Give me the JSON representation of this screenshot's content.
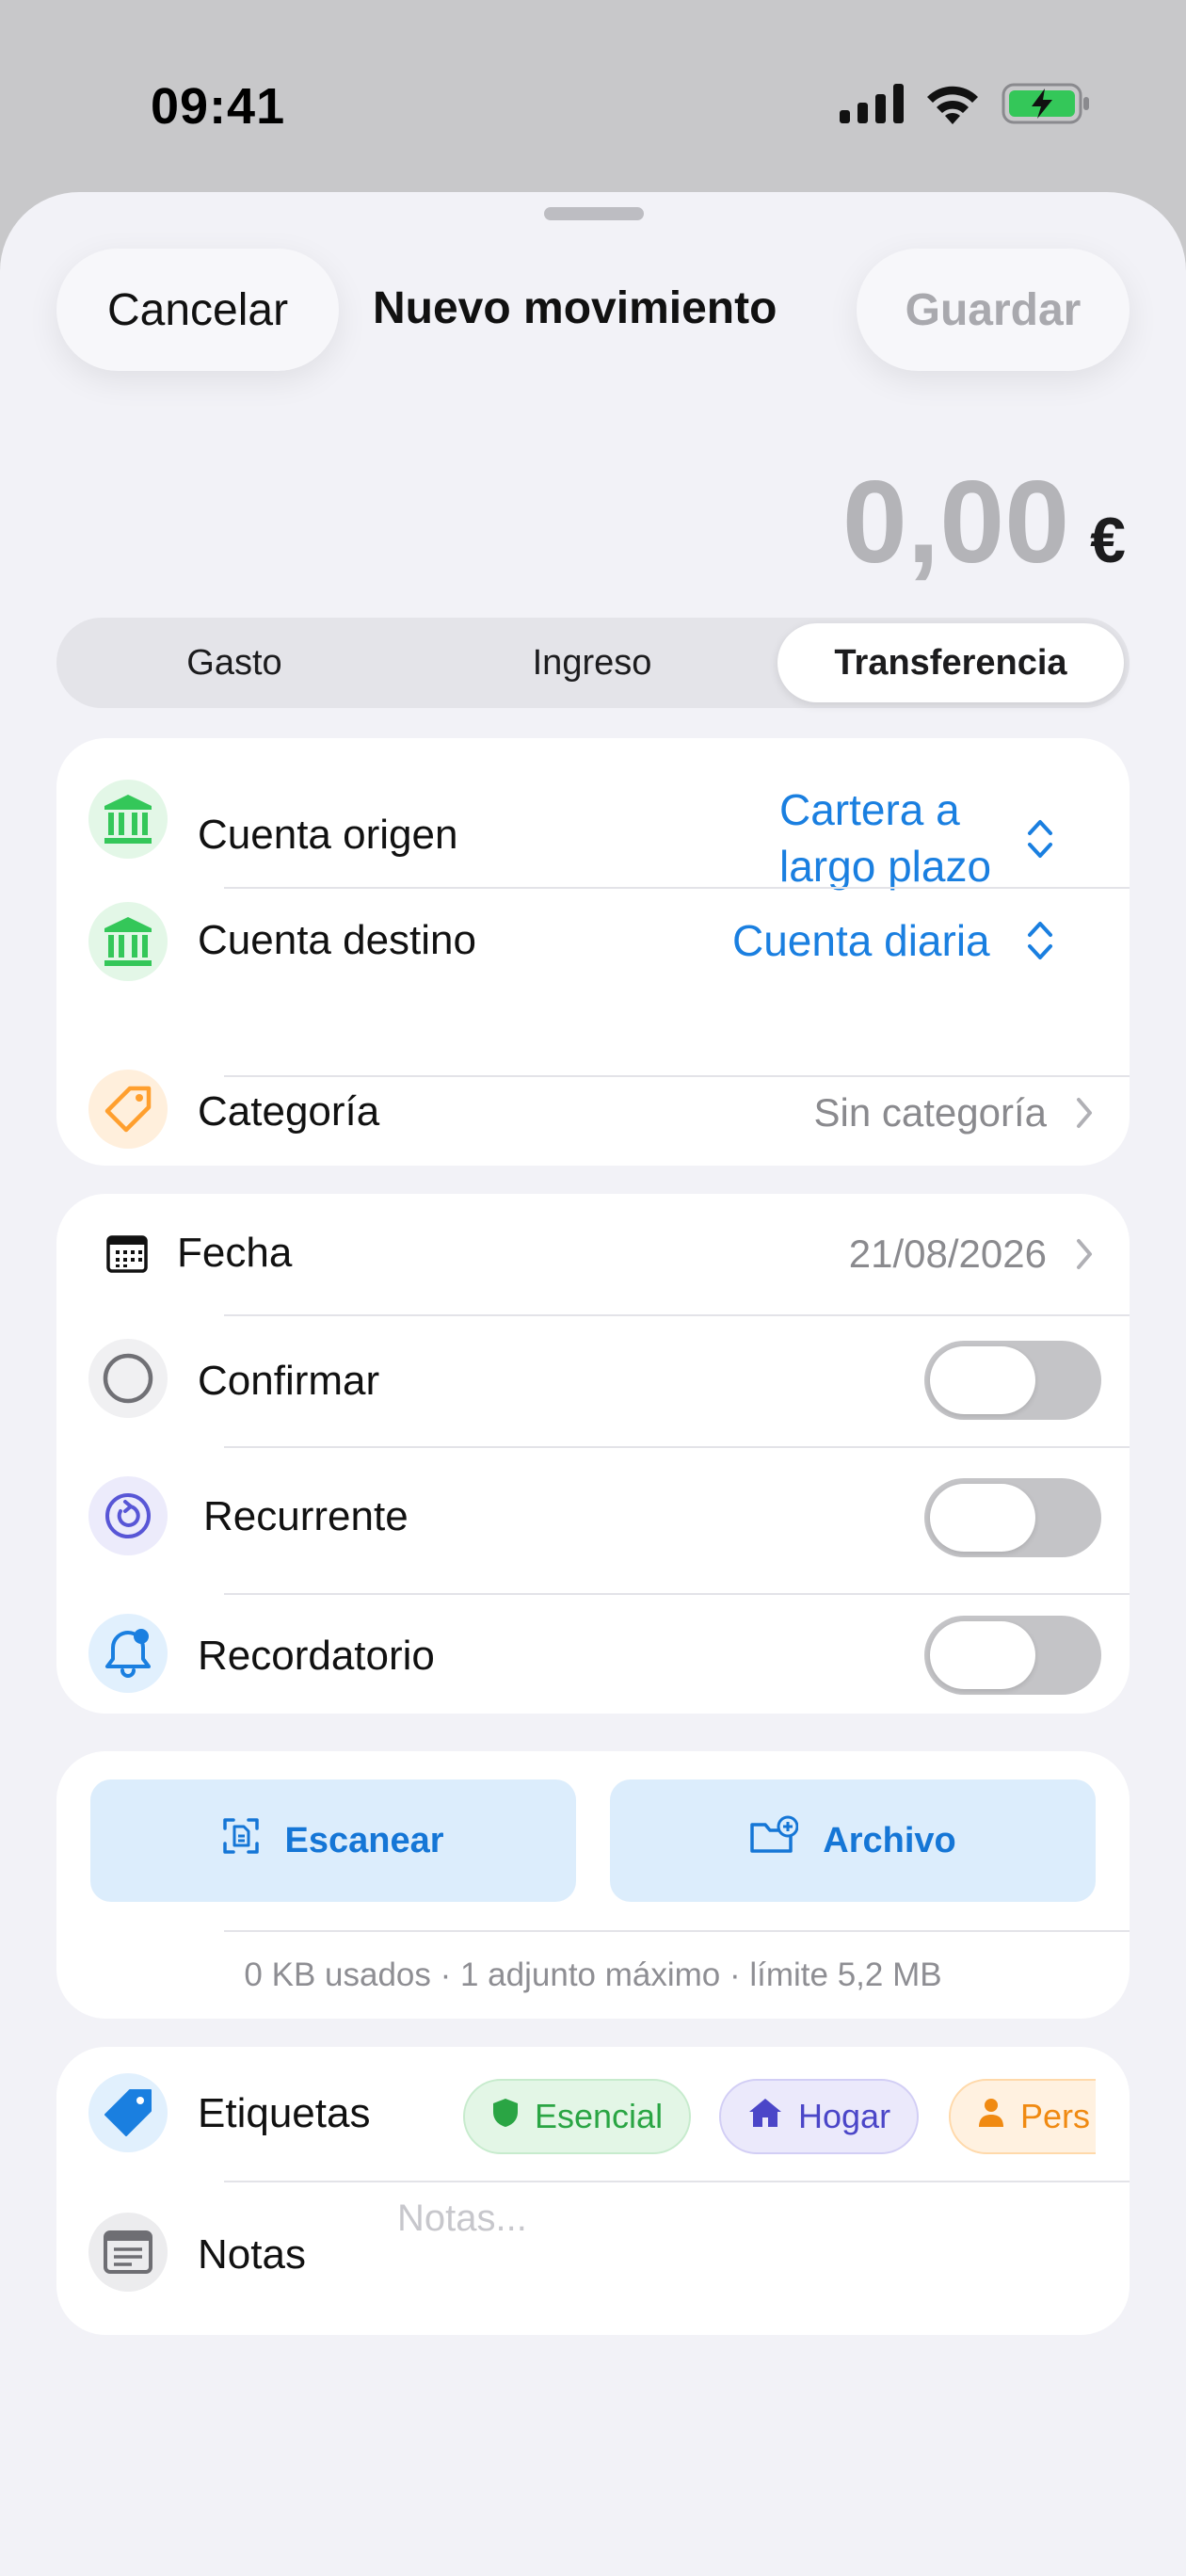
{
  "status_bar": {
    "time": "09:41"
  },
  "header": {
    "cancel_label": "Cancelar",
    "title": "Nuevo movimiento",
    "save_label": "Guardar"
  },
  "amount": {
    "value": "0,00",
    "currency": "€"
  },
  "segmented": {
    "options": [
      "Gasto",
      "Ingreso",
      "Transferencia"
    ],
    "selected": "Transferencia"
  },
  "accounts_card": {
    "origin": {
      "label": "Cuenta origen",
      "value_line1": "Cartera a",
      "value_line2": "largo plazo"
    },
    "destination": {
      "label": "Cuenta destino",
      "value": "Cuenta diaria"
    },
    "category": {
      "label": "Categoría",
      "value": "Sin categoría"
    }
  },
  "options_card": {
    "date": {
      "label": "Fecha",
      "value": "21/08/2026"
    },
    "confirm": {
      "label": "Confirmar",
      "on": false
    },
    "recurring": {
      "label": "Recurrente",
      "on": false
    },
    "reminder": {
      "label": "Recordatorio",
      "on": false
    }
  },
  "attachments_card": {
    "scan_label": "Escanear",
    "file_label": "Archivo",
    "usage_text": "0 KB usados · 1 adjunto máximo · límite 5,2 MB"
  },
  "extras_card": {
    "tags_label": "Etiquetas",
    "tags": [
      "Esencial",
      "Hogar",
      "Pers"
    ],
    "notes_label": "Notas",
    "notes_placeholder": "Notas..."
  },
  "colors": {
    "accent_blue": "#1a7fe0",
    "bank_green": "#34c759",
    "category_orange": "#ff9f2e",
    "recurring_purple": "#5856d6",
    "toggle_off": "#c4c4c7"
  },
  "icons": {
    "signal": "cellular-signal-icon",
    "wifi": "wifi-icon",
    "battery": "battery-charging-icon",
    "bank": "bank-icon",
    "tag": "tag-icon",
    "calendar": "calendar-icon",
    "circle": "circle-icon",
    "recurring": "repeat-icon",
    "bell": "bell-badge-icon",
    "scan": "scan-document-icon",
    "folder": "folder-add-icon",
    "notes": "notes-icon"
  }
}
